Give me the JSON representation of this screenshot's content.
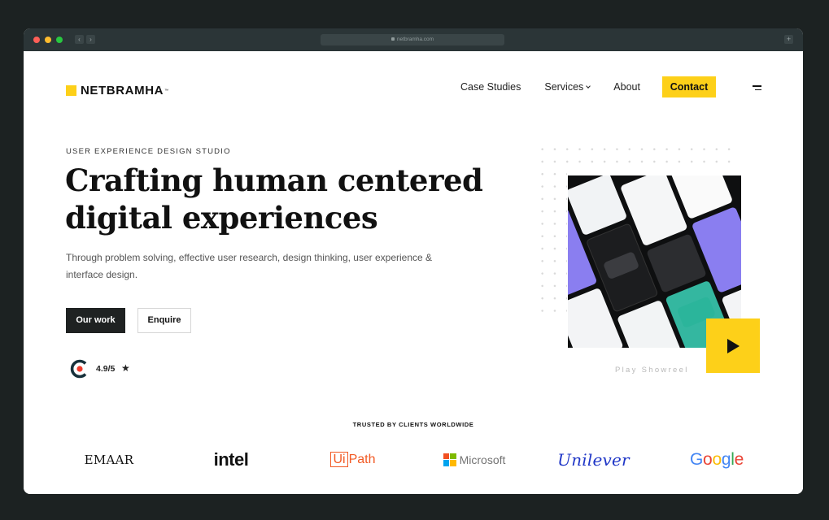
{
  "browser": {
    "url": "netbramha.com",
    "back_glyph": "‹",
    "forward_glyph": "›",
    "new_tab_glyph": "+"
  },
  "header": {
    "brand": "NETBRAMHA",
    "brand_tm": "™",
    "nav": [
      {
        "label": "Case Studies"
      },
      {
        "label": "Services"
      },
      {
        "label": "About"
      }
    ],
    "cta": "Contact"
  },
  "hero": {
    "eyebrow": "USER EXPERIENCE DESIGN STUDIO",
    "headline_plain_1": "Crafting ",
    "headline_bold": "human centered",
    "headline_plain_2": "digital experiences",
    "lead": "Through problem solving, effective user research, design thinking, user experience & interface design.",
    "primary_button": "Our work",
    "secondary_button": "Enquire",
    "rating": "4.9/5",
    "rating_icon": "star-icon"
  },
  "showreel": {
    "label": "Play Showreel",
    "icon": "play-icon"
  },
  "clients": {
    "heading": "TRUSTED BY CLIENTS WORLDWIDE",
    "logos": {
      "emaar": "EMAAR",
      "intel": "intel",
      "uipath_ui": "Ui",
      "uipath_rest": "Path",
      "microsoft": "Microsoft",
      "unilever": "Unilever",
      "google": [
        "G",
        "o",
        "o",
        "g",
        "l",
        "e"
      ]
    }
  },
  "colors": {
    "accent": "#fdd019",
    "dark": "#1f2222",
    "google": [
      "#4285f4",
      "#ea4335",
      "#fbbc05",
      "#4285f4",
      "#34a853",
      "#ea4335"
    ]
  }
}
